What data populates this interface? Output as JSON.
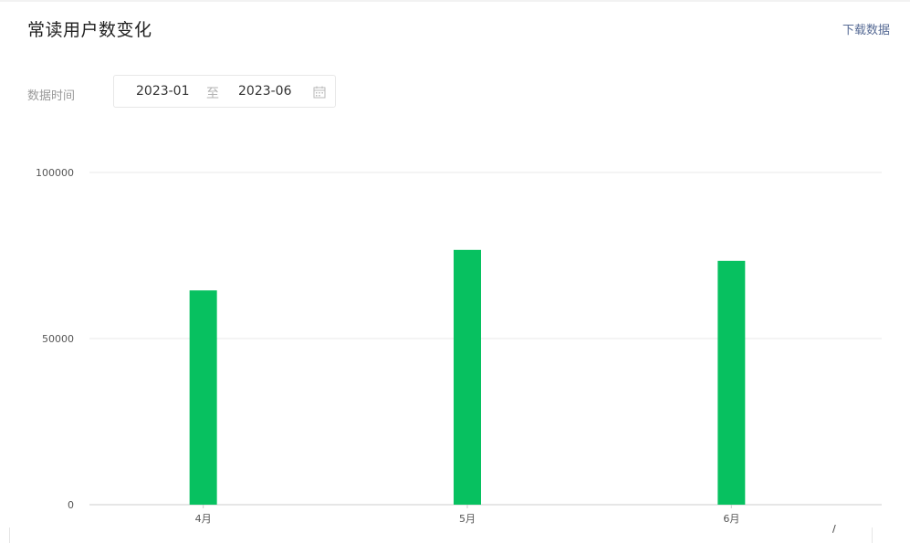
{
  "header": {
    "title": "常读用户数变化",
    "download_label": "下载数据"
  },
  "filter": {
    "label": "数据时间",
    "start": "2023-01",
    "separator": "至",
    "end": "2023-06"
  },
  "colors": {
    "bar": "#07c160",
    "grid": "#e8e8e8",
    "axis": "#cccccc",
    "tick_text": "#555555",
    "link": "#576b95"
  },
  "chart_data": {
    "type": "bar",
    "title": "",
    "xlabel": "",
    "ylabel": "",
    "categories": [
      "4月",
      "5月",
      "6月"
    ],
    "values": [
      64500,
      76700,
      73400
    ],
    "ylim": [
      0,
      100000
    ],
    "yticks": [
      0,
      50000,
      100000
    ],
    "ytick_labels": [
      "0",
      "50000",
      "100000"
    ],
    "grid": true,
    "legend": "none"
  }
}
